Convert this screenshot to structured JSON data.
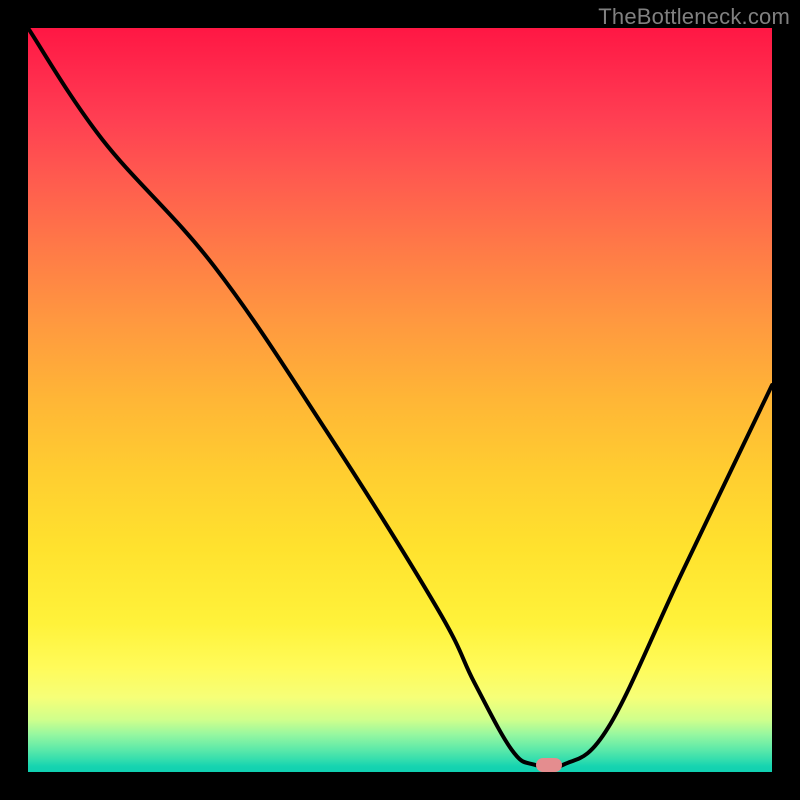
{
  "watermark": {
    "text": "TheBottleneck.com"
  },
  "colors": {
    "page_bg": "#000000",
    "curve": "#000000",
    "marker": "#e48d8f",
    "watermark": "#808080"
  },
  "chart_data": {
    "type": "line",
    "title": "",
    "xlabel": "",
    "ylabel": "",
    "xlim": [
      0,
      100
    ],
    "ylim": [
      0,
      100
    ],
    "grid": false,
    "legend": false,
    "series": [
      {
        "name": "bottleneck-curve",
        "x": [
          0,
          10,
          25,
          40,
          55,
          60,
          65,
          68,
          72,
          78,
          88,
          100
        ],
        "values": [
          100,
          85,
          68,
          46,
          22,
          12,
          3,
          1,
          1,
          6,
          27,
          52
        ]
      }
    ],
    "marker": {
      "x": 70,
      "y": 1
    }
  }
}
